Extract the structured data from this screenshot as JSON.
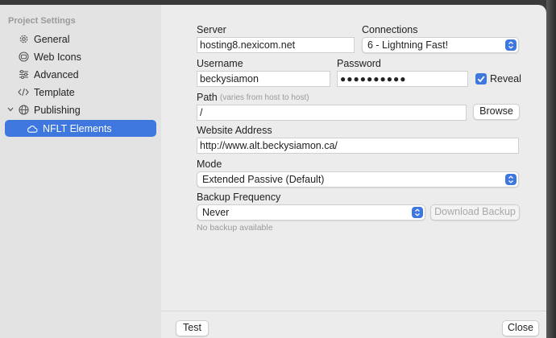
{
  "sidebar": {
    "title": "Project Settings",
    "items": [
      {
        "label": "General",
        "icon": "gear-icon"
      },
      {
        "label": "Web Icons",
        "icon": "web-icons-icon"
      },
      {
        "label": "Advanced",
        "icon": "sliders-icon"
      },
      {
        "label": "Template",
        "icon": "code-icon"
      },
      {
        "label": "Publishing",
        "icon": "globe-icon"
      },
      {
        "label": "NFLT Elements",
        "icon": "cloud-icon"
      }
    ]
  },
  "form": {
    "server_label": "Server",
    "server_value": "hosting8.nexicom.net",
    "connections_label": "Connections",
    "connections_value": "6 - Lightning Fast!",
    "username_label": "Username",
    "username_value": "beckysiamon",
    "password_label": "Password",
    "password_masked": "●●●●●●●●●●",
    "reveal_label": "Reveal",
    "reveal_checked": true,
    "path_label": "Path",
    "path_hint": "(varies from host to host)",
    "path_value": "/",
    "browse_label": "Browse",
    "website_label": "Website Address",
    "website_value": "http://www.alt.beckysiamon.ca/",
    "mode_label": "Mode",
    "mode_value": "Extended Passive (Default)",
    "backup_label": "Backup Frequency",
    "backup_value": "Never",
    "download_backup_label": "Download Backup",
    "backup_status": "No backup available"
  },
  "footer": {
    "test_label": "Test",
    "close_label": "Close"
  },
  "colors": {
    "accent": "#3e78df",
    "sidebar_bg": "#e3e3e3",
    "window_bg": "#ececec"
  }
}
